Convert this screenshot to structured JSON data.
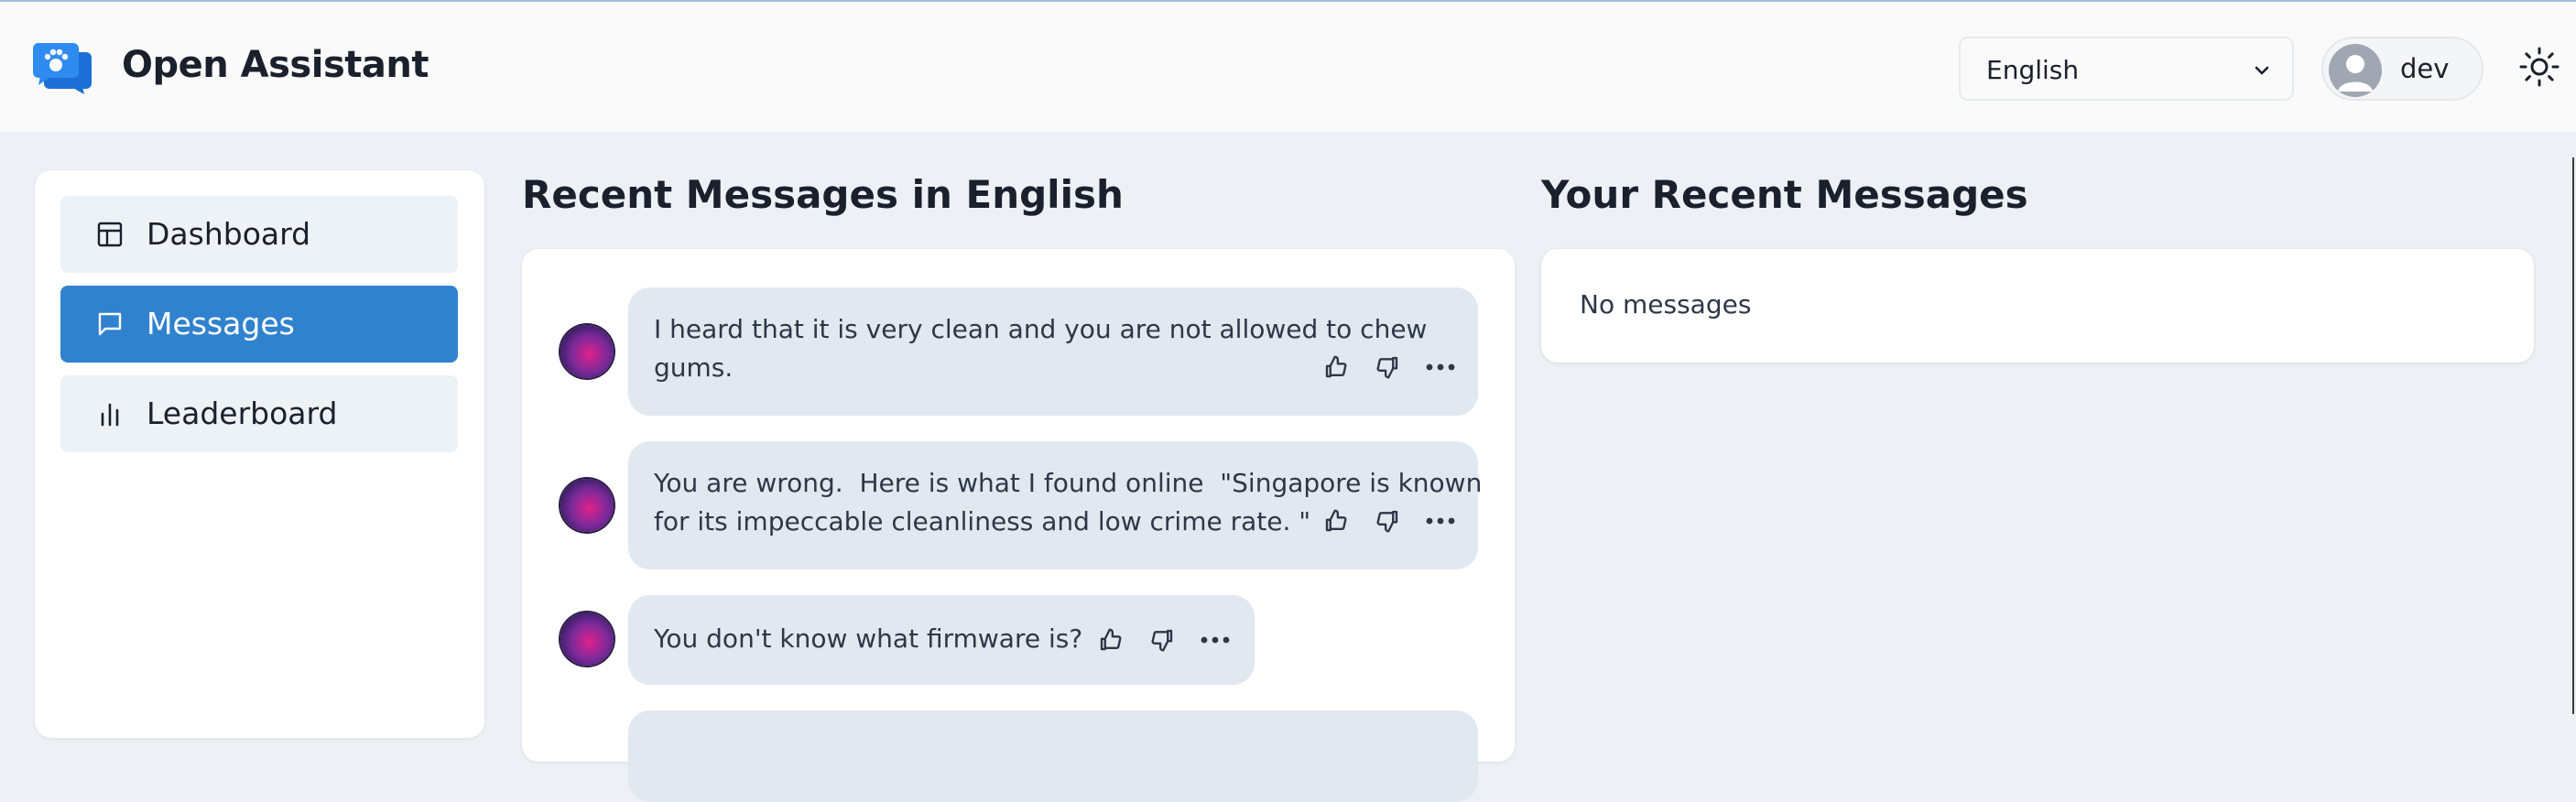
{
  "header": {
    "app_title": "Open Assistant",
    "language_select": {
      "value": "English"
    },
    "user": {
      "name": "dev"
    }
  },
  "sidebar": {
    "items": [
      {
        "label": "Dashboard",
        "icon": "layout-icon",
        "active": false
      },
      {
        "label": "Messages",
        "icon": "message-icon",
        "active": true
      },
      {
        "label": "Leaderboard",
        "icon": "bar-chart-icon",
        "active": false
      }
    ]
  },
  "recent_messages": {
    "title": "Recent Messages in English",
    "messages": [
      {
        "text": "I heard that it is very clean and you are not allowed to chew\ngums."
      },
      {
        "text": "You are wrong.  Here is what I found online  \"Singapore is known\nfor its impeccable cleanliness and low crime rate. \""
      },
      {
        "text": "You don't know what firmware is?"
      }
    ]
  },
  "your_messages": {
    "title": "Your Recent Messages",
    "empty_text": "No messages"
  },
  "colors": {
    "accent": "#3182ce",
    "page_bg": "#edf1f6",
    "bubble_bg": "#e2e8f0"
  }
}
